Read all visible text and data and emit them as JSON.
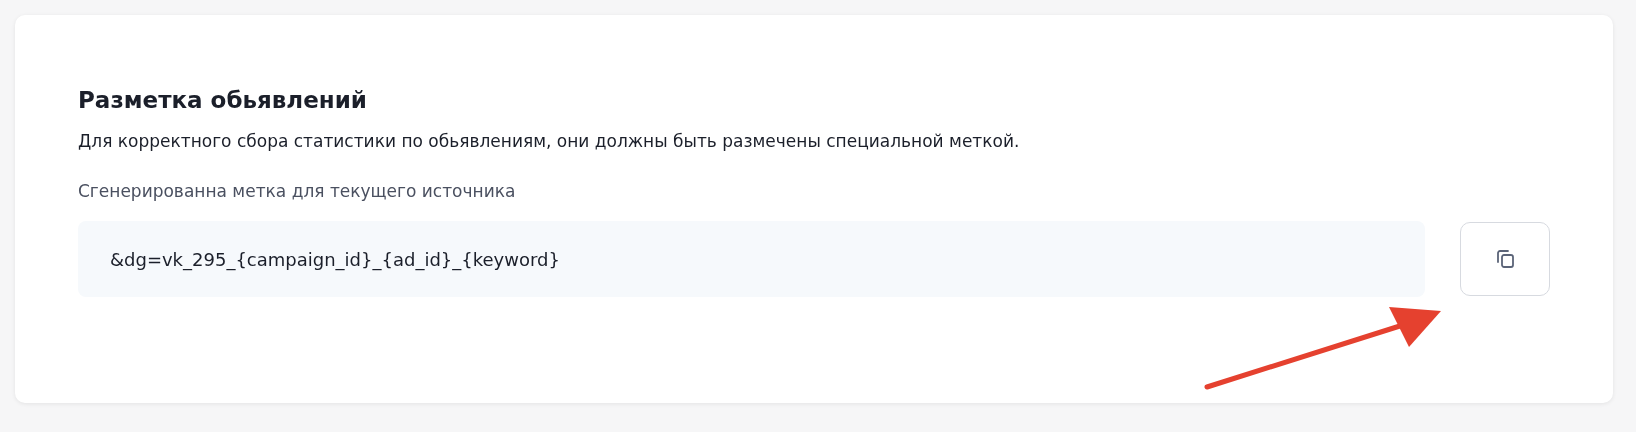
{
  "card": {
    "title": "Разметка обьявлений",
    "description": "Для корректного сбора статистики по обьявлениям, они должны быть размечены специальной меткой.",
    "field_label": "Сгенерированна метка для текущего источника",
    "field_value": "&dg=vk_295_{campaign_id}_{ad_id}_{keyword}"
  }
}
